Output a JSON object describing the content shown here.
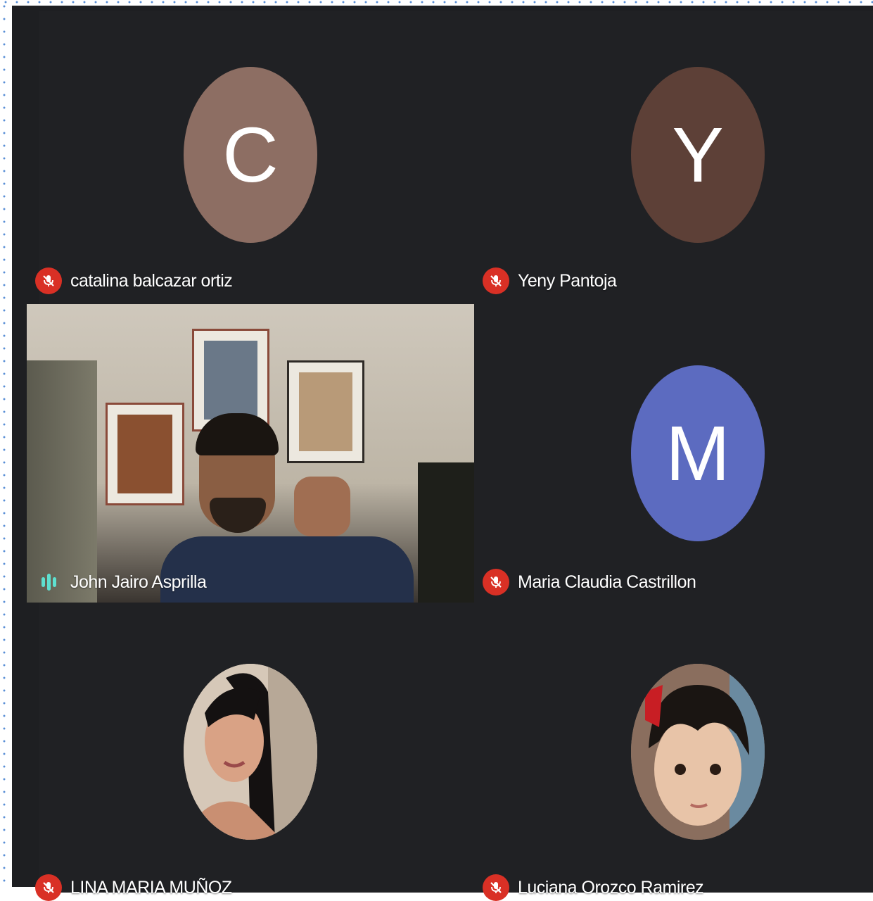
{
  "participants": [
    {
      "name": "catalina balcazar ortiz",
      "initial": "C",
      "avatar_color": "#8d6e63",
      "muted": true
    },
    {
      "name": "Yeny Pantoja",
      "initial": "Y",
      "avatar_color": "#5d4037",
      "muted": true
    },
    {
      "name": "John Jairo Asprilla",
      "muted": false,
      "speaking": true
    },
    {
      "name": "Maria Claudia Castrillon",
      "initial": "M",
      "avatar_color": "#5c6bc0",
      "muted": true
    },
    {
      "name": "LINA MARIA MUÑOZ",
      "muted": true
    },
    {
      "name": "Luciana Orozco Ramirez",
      "muted": true
    }
  ],
  "icons": {
    "muted": "mic-off-icon",
    "speaking": "audio-level-icon"
  },
  "colors": {
    "background": "#202124",
    "mic_muted": "#d93025",
    "speaking": "#5ee0d0"
  }
}
